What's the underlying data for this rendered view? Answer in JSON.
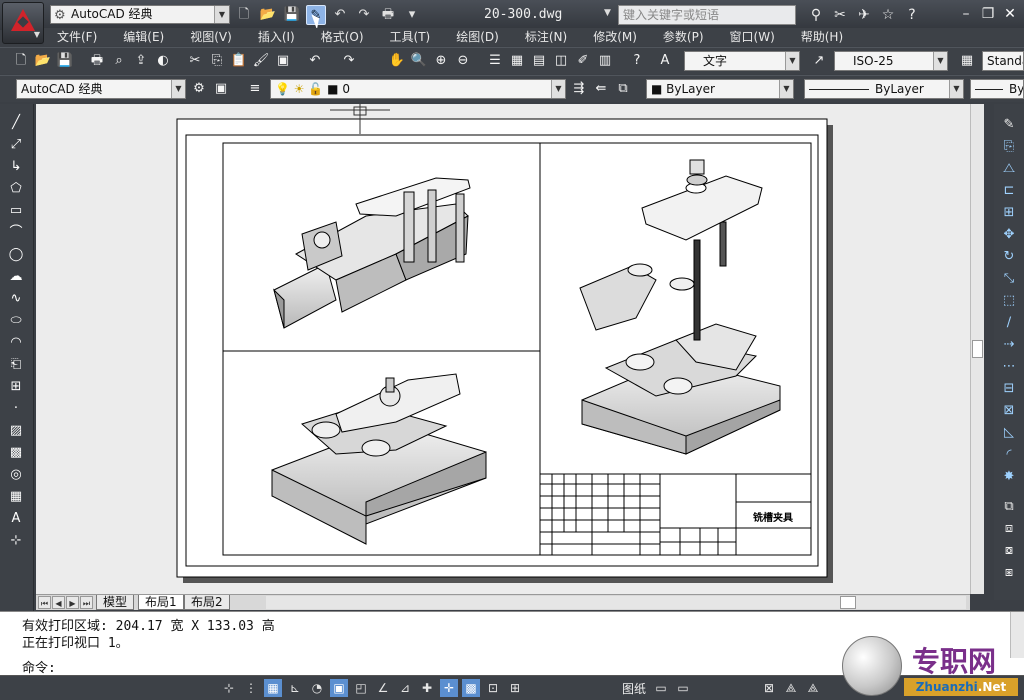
{
  "app": {
    "workspace": "AutoCAD 经典",
    "file_name": "20-300.dwg",
    "search_placeholder": "键入关键字或短语"
  },
  "menu": [
    "文件(F)",
    "编辑(E)",
    "视图(V)",
    "插入(I)",
    "格式(O)",
    "工具(T)",
    "绘图(D)",
    "标注(N)",
    "修改(M)",
    "参数(P)",
    "窗口(W)",
    "帮助(H)"
  ],
  "toolbars": {
    "text_style": "文字",
    "dim_style": "ISO-25",
    "table_style": "Standa",
    "workspace_combo": "AutoCAD 经典",
    "layer": "0",
    "color": "ByLayer",
    "linetype": "ByLayer",
    "lineweight": "By"
  },
  "layout_tabs": [
    "模型",
    "布局1",
    "布局2"
  ],
  "active_tab": "布局1",
  "command": {
    "line1": "有效打印区域:  204.17 宽 X 133.03 高",
    "line2": "正在打印视口 1。",
    "prompt": "命令:"
  },
  "status": {
    "paper": "图纸"
  },
  "title_block": {
    "drawing_name": "铣槽夹具"
  },
  "watermark": {
    "text": "专职网",
    "url_left": "Zhuanzhi",
    "url_right": ".Net"
  }
}
